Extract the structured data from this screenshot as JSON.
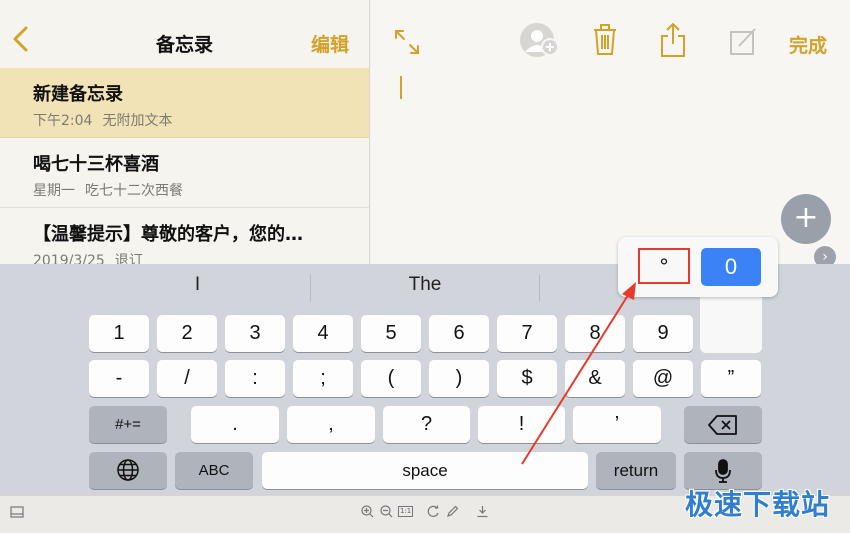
{
  "window": {
    "minimize_icon": "—",
    "restore_icon": "□",
    "close_icon": "✕"
  },
  "sidebar": {
    "title": "备忘录",
    "edit_label": "编辑",
    "notes": [
      {
        "title": "新建备忘录",
        "date": "下午2:04",
        "preview": "无附加文本"
      },
      {
        "title": "喝七十三杯喜酒",
        "date": "星期一",
        "preview": "吃七十二次西餐"
      },
      {
        "title": "【温馨提示】尊敬的客户，您的…",
        "date": "2019/3/25",
        "preview": "退订"
      }
    ]
  },
  "toolbar": {
    "done_label": "完成",
    "fab_label": "+",
    "arrow_label": "›"
  },
  "keyboard": {
    "suggestions": [
      "I",
      "The"
    ],
    "row1": [
      "1",
      "2",
      "3",
      "4",
      "5",
      "6",
      "7",
      "8",
      "9"
    ],
    "row2": [
      "-",
      "/",
      ":",
      ";",
      "(",
      ")",
      "$",
      "&",
      "@",
      "”"
    ],
    "row3_left": "#+=",
    "row3": [
      ".",
      ",",
      "?",
      "!",
      "’"
    ],
    "row4": {
      "globe_icon": "globe-icon",
      "abc": "ABC",
      "space": "space",
      "return": "return",
      "mic_icon": "microphone-icon"
    },
    "popup": {
      "degree": "°",
      "zero": "0"
    }
  },
  "bottom_bar": {
    "fit_label": "1:1"
  },
  "watermark": "极速下载站",
  "colors": {
    "accent": "#d2a22b",
    "selected_row": "#f2e3b6",
    "popup_blue": "#3b82f6",
    "annotation_red": "#e63a2c",
    "watermark": "#2f7ed0"
  }
}
